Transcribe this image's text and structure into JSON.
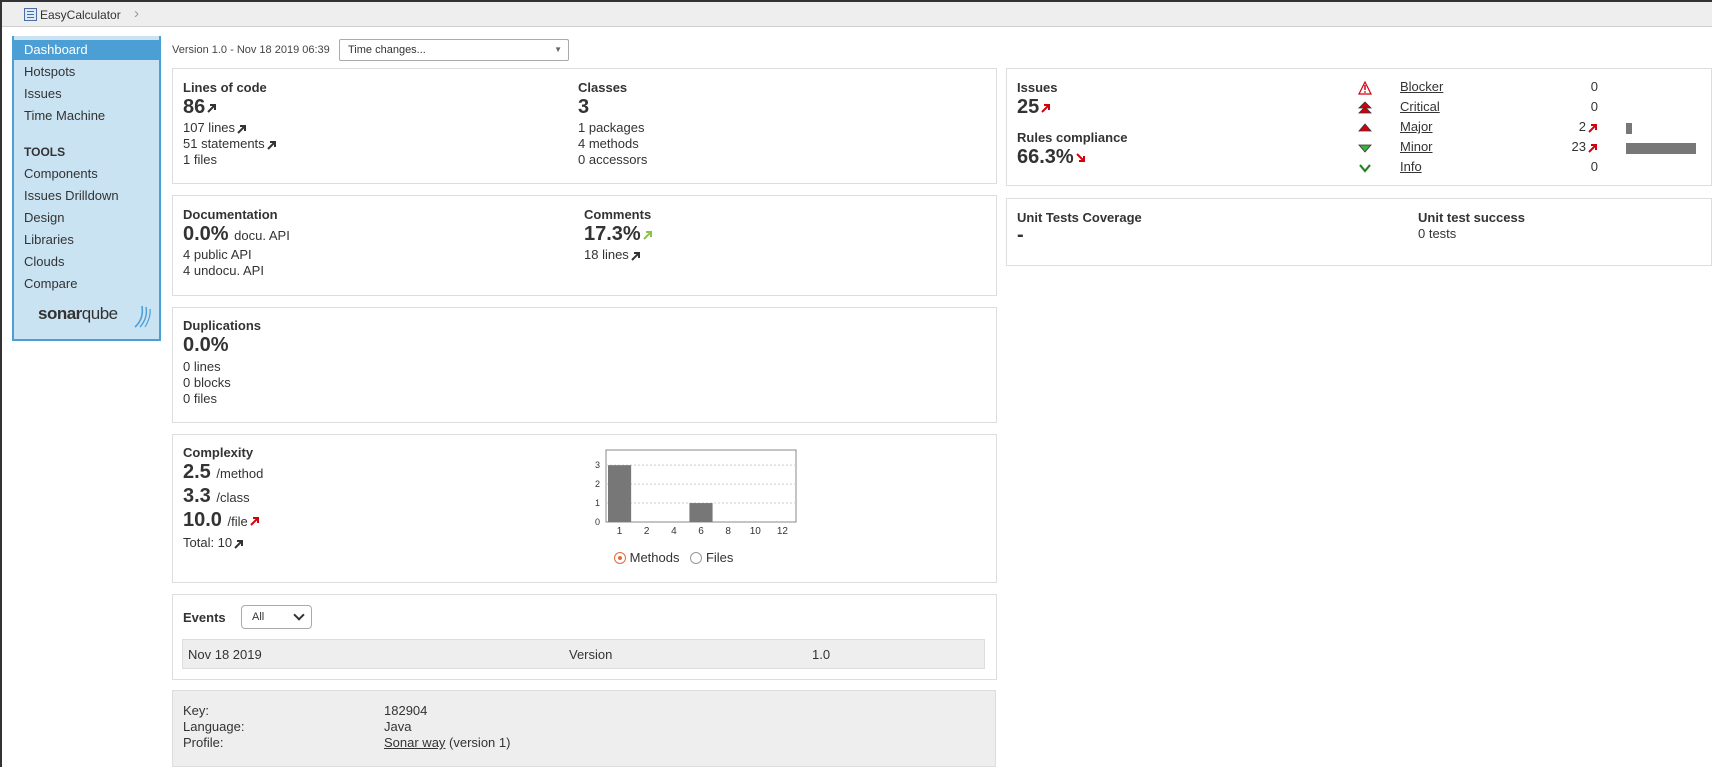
{
  "breadcrumb": {
    "project": "EasyCalculator"
  },
  "sidebar": {
    "items": [
      {
        "label": "Dashboard",
        "active": true
      },
      {
        "label": "Hotspots"
      },
      {
        "label": "Issues"
      },
      {
        "label": "Time Machine"
      }
    ],
    "tools_heading": "TOOLS",
    "tools": [
      "Components",
      "Issues Drilldown",
      "Design",
      "Libraries",
      "Clouds",
      "Compare"
    ],
    "logo": {
      "bold": "sonar",
      "thin": "qube"
    }
  },
  "version": {
    "text": "Version 1.0 - Nov 18 2019 06:39",
    "time_changes": "Time changes..."
  },
  "size": {
    "loc_title": "Lines of code",
    "loc": "86",
    "lines": "107 lines",
    "statements": "51 statements",
    "files": "1 files",
    "classes_title": "Classes",
    "classes": "3",
    "packages": "1 packages",
    "methods": "4 methods",
    "accessors": "0 accessors"
  },
  "issues": {
    "title": "Issues",
    "count": "25",
    "rules_title": "Rules compliance",
    "rules_value": "66.3%",
    "severities": [
      {
        "name": "Blocker",
        "count": "0",
        "bar_fraction": 0,
        "trend": ""
      },
      {
        "name": "Critical",
        "count": "0",
        "bar_fraction": 0,
        "trend": ""
      },
      {
        "name": "Major",
        "count": "2",
        "bar_fraction": 0.087,
        "trend": "up-red"
      },
      {
        "name": "Minor",
        "count": "23",
        "bar_fraction": 1,
        "trend": "up-red"
      },
      {
        "name": "Info",
        "count": "0",
        "bar_fraction": 0,
        "trend": ""
      }
    ]
  },
  "documentation": {
    "title": "Documentation",
    "value": "0.0%",
    "suffix": "docu. API",
    "public_api": "4 public API",
    "undocu_api": "4 undocu. API",
    "comments_title": "Comments",
    "comments_value": "17.3%",
    "comment_lines": "18 lines"
  },
  "tests": {
    "coverage_title": "Unit Tests Coverage",
    "coverage_value": "-",
    "success_title": "Unit test success",
    "success_value": "0 tests"
  },
  "duplications": {
    "title": "Duplications",
    "value": "0.0%",
    "lines": "0 lines",
    "blocks": "0 blocks",
    "files": "0 files"
  },
  "complexity": {
    "title": "Complexity",
    "per_method": "2.5",
    "per_method_unit": "/method",
    "per_class": "3.3",
    "per_class_unit": "/class",
    "per_file": "10.0",
    "per_file_unit": "/file",
    "total": "Total: 10",
    "radio_methods": "Methods",
    "radio_files": "Files"
  },
  "chart_data": {
    "type": "bar",
    "categories": [
      "1",
      "2",
      "4",
      "6",
      "8",
      "10",
      "12"
    ],
    "values": [
      3,
      0,
      0,
      1,
      0,
      0,
      0
    ],
    "ylim": [
      0,
      3.8
    ],
    "yticks": [
      "0",
      "1",
      "2",
      "3"
    ],
    "grid": true,
    "title": "",
    "xlabel": "",
    "ylabel": ""
  },
  "events": {
    "title": "Events",
    "filter": "All",
    "rows": [
      {
        "date": "Nov 18 2019",
        "category": "Version",
        "name": "1.0"
      }
    ]
  },
  "project_info": {
    "key_label": "Key:",
    "key": "182904",
    "language_label": "Language:",
    "language": "Java",
    "profile_label": "Profile:",
    "profile_link": "Sonar way",
    "profile_version": "(version 1)"
  }
}
